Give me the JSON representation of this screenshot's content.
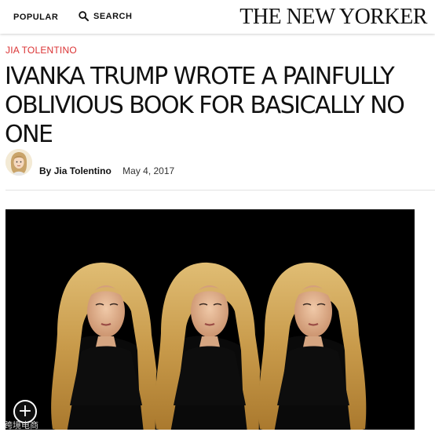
{
  "header": {
    "popular_label": "POPULAR",
    "search_label": "SEARCH",
    "logo_text": "THE NEW YORKER"
  },
  "article": {
    "rubric": "JIA TOLENTINO",
    "headline": "IVANKA TRUMP WROTE A PAINFULLY OBLIVIOUS BOOK FOR BASICALLY NO ONE",
    "byline_prefix": "By",
    "author": "Jia Tolentino",
    "date": "May 4, 2017"
  },
  "image": {
    "icons": [
      "expand-icon"
    ]
  },
  "watermark": "跨境电商"
}
